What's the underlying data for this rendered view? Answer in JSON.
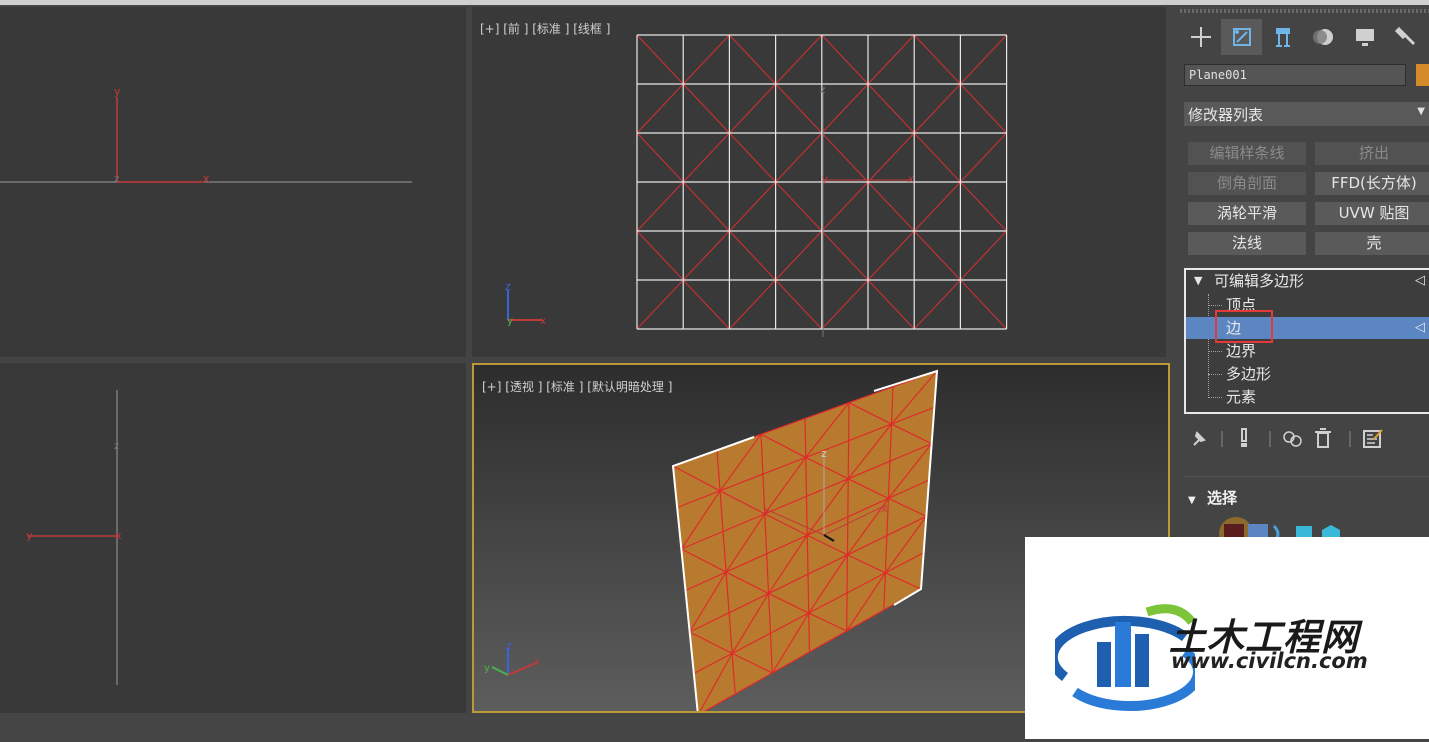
{
  "viewports": {
    "front": {
      "label": "[+] [前 ] [标准 ] [线框 ]"
    },
    "perspective": {
      "label": "[+] [透视 ] [标准 ] [默认明暗处理 ]"
    },
    "axes": {
      "x": "x",
      "y": "y",
      "z": "z"
    }
  },
  "panel": {
    "tabs": [
      {
        "icon": "plus-icon"
      },
      {
        "icon": "modify-icon"
      },
      {
        "icon": "hierarchy-icon"
      },
      {
        "icon": "motion-icon"
      },
      {
        "icon": "display-icon"
      },
      {
        "icon": "utilities-icon"
      }
    ],
    "object_name": "Plane001",
    "object_color": "#d58b2a",
    "modifier_list": "修改器列表",
    "modifier_buttons": [
      {
        "label": "编辑样条线",
        "enabled": false
      },
      {
        "label": "挤出",
        "enabled": false
      },
      {
        "label": "倒角剖面",
        "enabled": false
      },
      {
        "label": "FFD(长方体)",
        "enabled": true
      },
      {
        "label": "涡轮平滑",
        "enabled": true
      },
      {
        "label": "UVW 贴图",
        "enabled": true
      },
      {
        "label": "法线",
        "enabled": true
      },
      {
        "label": "壳",
        "enabled": true
      }
    ],
    "stack": {
      "root": "可编辑多边形",
      "items": [
        "顶点",
        "边",
        "边界",
        "多边形",
        "元素"
      ],
      "selected": "边"
    },
    "rollout_title": "选择"
  },
  "watermark": {
    "title": "土木工程网",
    "url": "www.civilcn.com"
  }
}
